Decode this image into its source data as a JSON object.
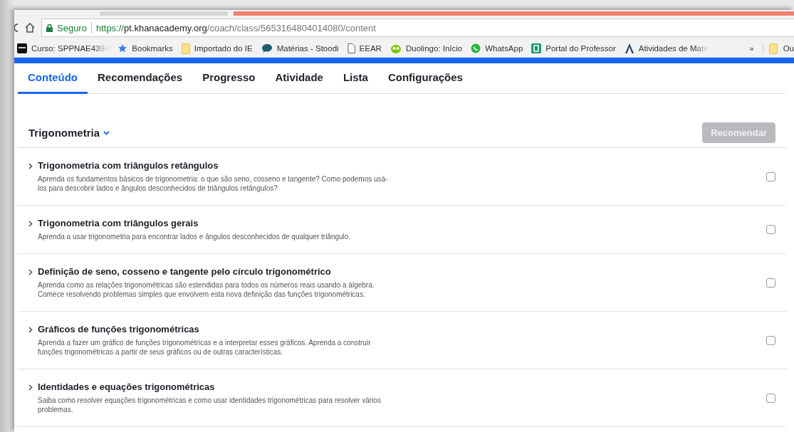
{
  "address_bar": {
    "security": "Seguro",
    "url": {
      "scheme": "https://",
      "host": "pt.khanacademy.org",
      "path": "/coach/class/5653164804014080/content"
    }
  },
  "bookmarks": [
    {
      "label": "Curso: SPPNAE4394"
    },
    {
      "label": "Bookmarks"
    },
    {
      "label": "Importado do IE"
    },
    {
      "label": "Matérias - Stoodi"
    },
    {
      "label": "EEAR"
    },
    {
      "label": "Duolingo: Início"
    },
    {
      "label": "WhatsApp"
    },
    {
      "label": "Portal do Professor"
    },
    {
      "label": "Atividades de Mate"
    }
  ],
  "bookmarks_more": "»",
  "bookmarks_other": "Ou",
  "tabs": [
    {
      "label": "Conteúdo",
      "selected": true
    },
    {
      "label": "Recomendações",
      "selected": false
    },
    {
      "label": "Progresso",
      "selected": false
    },
    {
      "label": "Atividade",
      "selected": false
    },
    {
      "label": "Lista",
      "selected": false
    },
    {
      "label": "Configurações",
      "selected": false
    }
  ],
  "subject": {
    "title": "Trigonometria",
    "recommend_button": {
      "label": "Recomendar",
      "disabled": true
    }
  },
  "topics": [
    {
      "title": "Trigonometria com triângulos retângulos",
      "description": "Aprenda os fundamentos básicos de trigonometria: o que são seno, cosseno e tangente? Como podemos usá-los para descobrir lados e ângulos desconhecidos de triângulos retângulos?",
      "checked": false
    },
    {
      "title": "Trigonometria com triângulos gerais",
      "description": "Aprenda a usar trigonometria para encontrar lados e ângulos desconhecidos de qualquer triângulo.",
      "checked": false
    },
    {
      "title": "Definição de seno, cosseno e tangente pelo círculo trigonométrico",
      "description": "Aprenda como as relações trigonométricas são estendidas para todos os números reais usando a álgebra. Comece resolvendo problemas simples que envolvem esta nova definição das funções trigonométricas.",
      "checked": false
    },
    {
      "title": "Gráficos de funções trigonométricas",
      "description": "Aprenda a fazer um gráfico de funções trigonométricas e a interpretar esses gráficos. Aprenda a construir funções trigonométricas a partir de seus gráficos ou de outras características.",
      "checked": false
    },
    {
      "title": "Identidades e equações trigonométricas",
      "description": "Saiba como resolver equações trigonométricas e como usar identidades trigonométricas para resolver vários problemas.",
      "checked": false
    }
  ]
}
